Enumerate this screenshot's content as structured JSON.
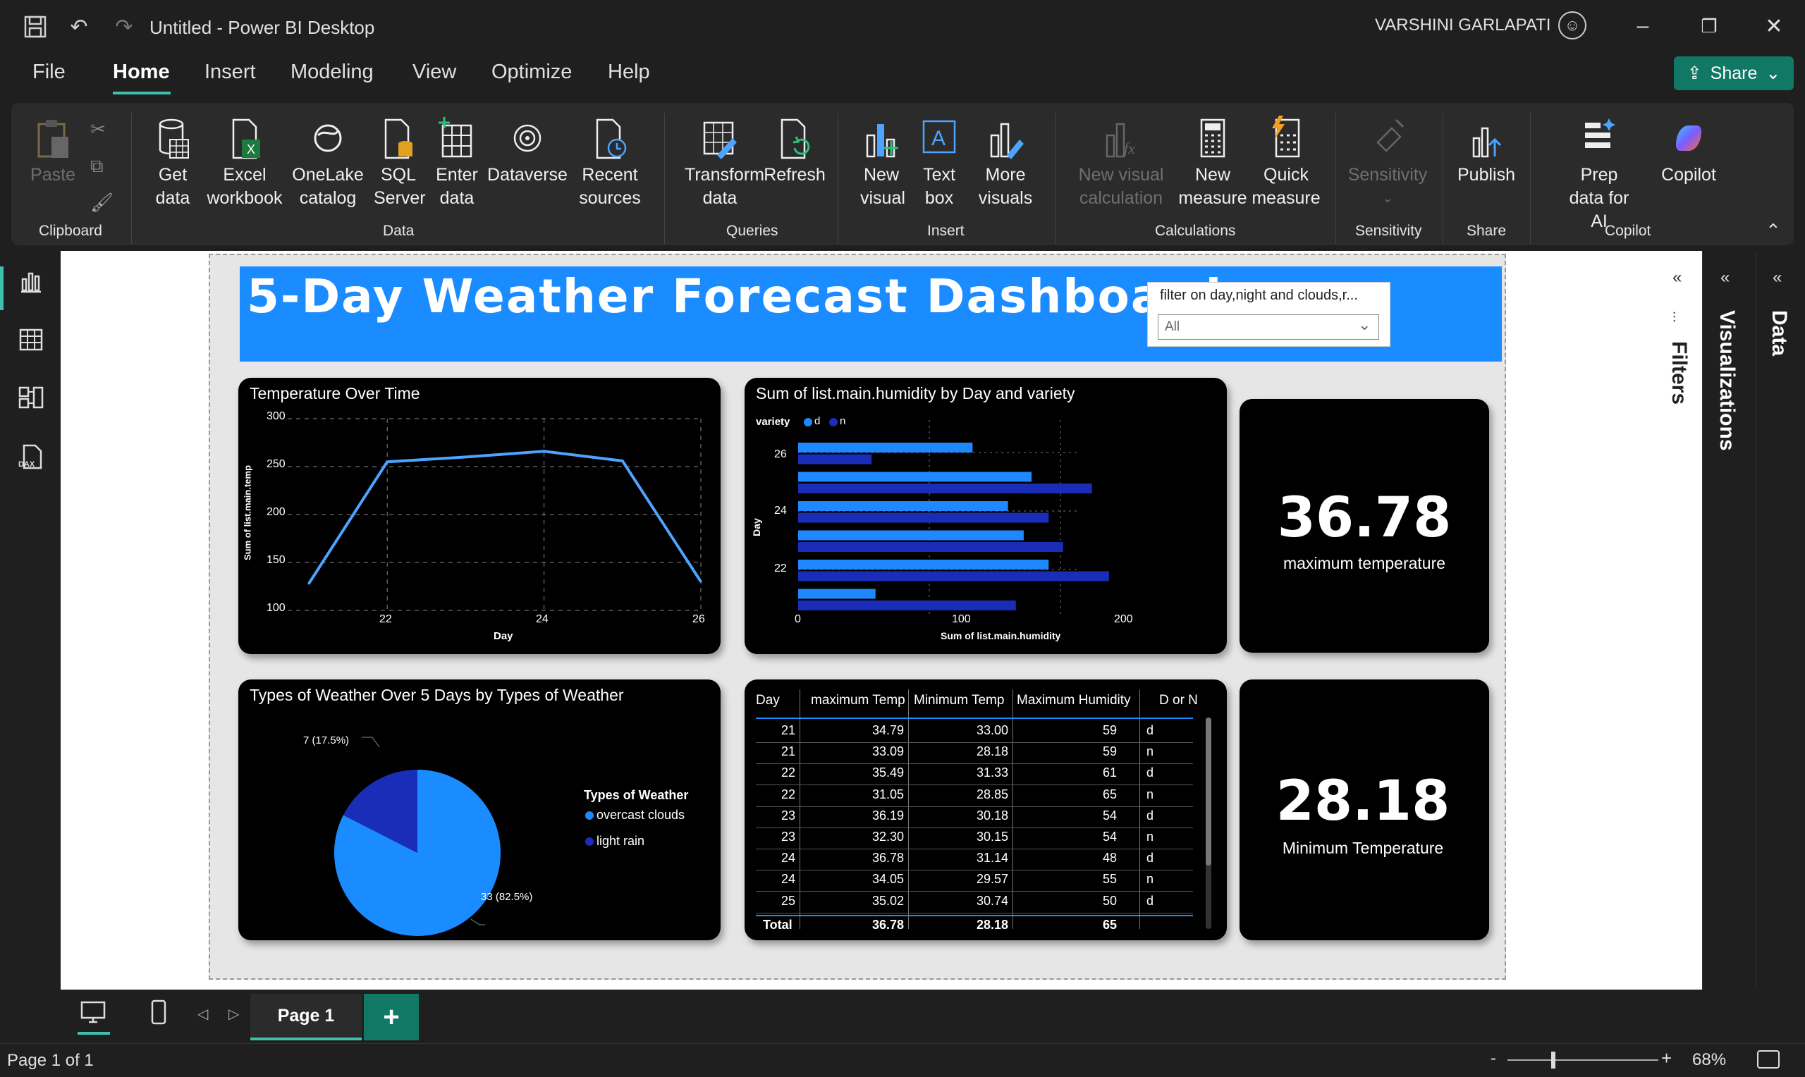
{
  "app": {
    "title": "Untitled - Power BI Desktop",
    "user": "VARSHINI GARLAPATI"
  },
  "menu": [
    "File",
    "Home",
    "Insert",
    "Modeling",
    "View",
    "Optimize",
    "Help"
  ],
  "share_label": "Share",
  "ribbon": {
    "paste": "Paste",
    "get_data": "Get data",
    "excel": "Excel workbook",
    "onelake": "OneLake catalog",
    "sql": "SQL Server",
    "enter_data": "Enter data",
    "dataverse": "Dataverse",
    "recent": "Recent sources",
    "transform": "Transform data",
    "refresh": "Refresh",
    "new_visual": "New visual",
    "text_box": "Text box",
    "more_visuals": "More visuals",
    "new_visual_calc": "New visual calculation",
    "new_measure": "New measure",
    "quick_measure": "Quick measure",
    "sensitivity": "Sensitivity",
    "publish": "Publish",
    "prep_data": "Prep data for AI",
    "copilot": "Copilot",
    "groups": {
      "clipboard": "Clipboard",
      "data": "Data",
      "queries": "Queries",
      "insert": "Insert",
      "calculations": "Calculations",
      "sensitivity": "Sensitivity",
      "share": "Share",
      "copilot": "Copilot"
    }
  },
  "dashboard": {
    "title": "5-Day Weather Forecast Dashboard",
    "slicer_title": "filter on day,night and clouds,r...",
    "slicer_value": "All"
  },
  "line_chart": {
    "title": "Temperature Over Time",
    "xlabel": "Day",
    "ylabel": "Sum of list.main.temp",
    "yticks": [
      "300",
      "250",
      "200",
      "150",
      "100"
    ],
    "xticks": [
      "22",
      "24",
      "26"
    ]
  },
  "bar_chart": {
    "title": "Sum of list.main.humidity by Day and variety",
    "legend_title": "variety",
    "legend": [
      "d",
      "n"
    ],
    "xlabel": "Sum of list.main.humidity",
    "ylabel": "Day",
    "yticks": [
      "26",
      "24",
      "22"
    ],
    "xticks": [
      "0",
      "100",
      "200"
    ]
  },
  "kpi1": {
    "value": "36.78",
    "label": "maximum temperature"
  },
  "kpi2": {
    "value": "28.18",
    "label": "Minimum Temperature"
  },
  "pie_chart": {
    "title": "Types of Weather Over 5 Days by Types of Weather",
    "legend_title": "Types of Weather",
    "legend": [
      "overcast clouds",
      "light rain"
    ],
    "label_small": "7 (17.5%)",
    "label_big": "33 (82.5%)"
  },
  "table": {
    "headers": [
      "Day",
      "maximum Temp",
      "Minimum Temp",
      "Maximum Humidity",
      "D or N"
    ],
    "rows": [
      [
        "21",
        "34.79",
        "33.00",
        "59",
        "d"
      ],
      [
        "21",
        "33.09",
        "28.18",
        "59",
        "n"
      ],
      [
        "22",
        "35.49",
        "31.33",
        "61",
        "d"
      ],
      [
        "22",
        "31.05",
        "28.85",
        "65",
        "n"
      ],
      [
        "23",
        "36.19",
        "30.18",
        "54",
        "d"
      ],
      [
        "23",
        "32.30",
        "30.15",
        "54",
        "n"
      ],
      [
        "24",
        "36.78",
        "31.14",
        "48",
        "d"
      ],
      [
        "24",
        "34.05",
        "29.57",
        "55",
        "n"
      ],
      [
        "25",
        "35.02",
        "30.74",
        "50",
        "d"
      ]
    ],
    "total": [
      "Total",
      "36.78",
      "28.18",
      "65",
      ""
    ]
  },
  "panes": {
    "filters": "Filters",
    "visualizations": "Visualizations",
    "data": "Data"
  },
  "page_tab": "Page 1",
  "status": {
    "page": "Page 1 of 1",
    "zoom": "68%"
  },
  "colors": {
    "accent": "#1a8cff",
    "series_d": "#1e88ff",
    "series_n": "#1a2db8",
    "teal": "#117865"
  },
  "chart_data": [
    {
      "type": "line",
      "title": "Temperature Over Time",
      "x": [
        21,
        22,
        23,
        24,
        25,
        26
      ],
      "values": [
        128,
        255,
        260,
        266,
        256,
        130
      ],
      "xlabel": "Day",
      "ylabel": "Sum of list.main.temp",
      "ylim": [
        100,
        300
      ]
    },
    {
      "type": "bar",
      "title": "Sum of list.main.humidity by Day and variety",
      "categories": [
        "26",
        "25",
        "24",
        "23",
        "22",
        "21"
      ],
      "series": [
        {
          "name": "d",
          "values": [
            133,
            178,
            160,
            172,
            191,
            59
          ]
        },
        {
          "name": "n",
          "values": [
            56,
            224,
            191,
            202,
            237,
            166
          ]
        }
      ],
      "xlabel": "Sum of list.main.humidity",
      "ylabel": "Day",
      "xlim": [
        0,
        250
      ]
    },
    {
      "type": "pie",
      "title": "Types of Weather Over 5 Days by Types of Weather",
      "categories": [
        "overcast clouds",
        "light rain"
      ],
      "values": [
        33,
        7
      ]
    }
  ]
}
